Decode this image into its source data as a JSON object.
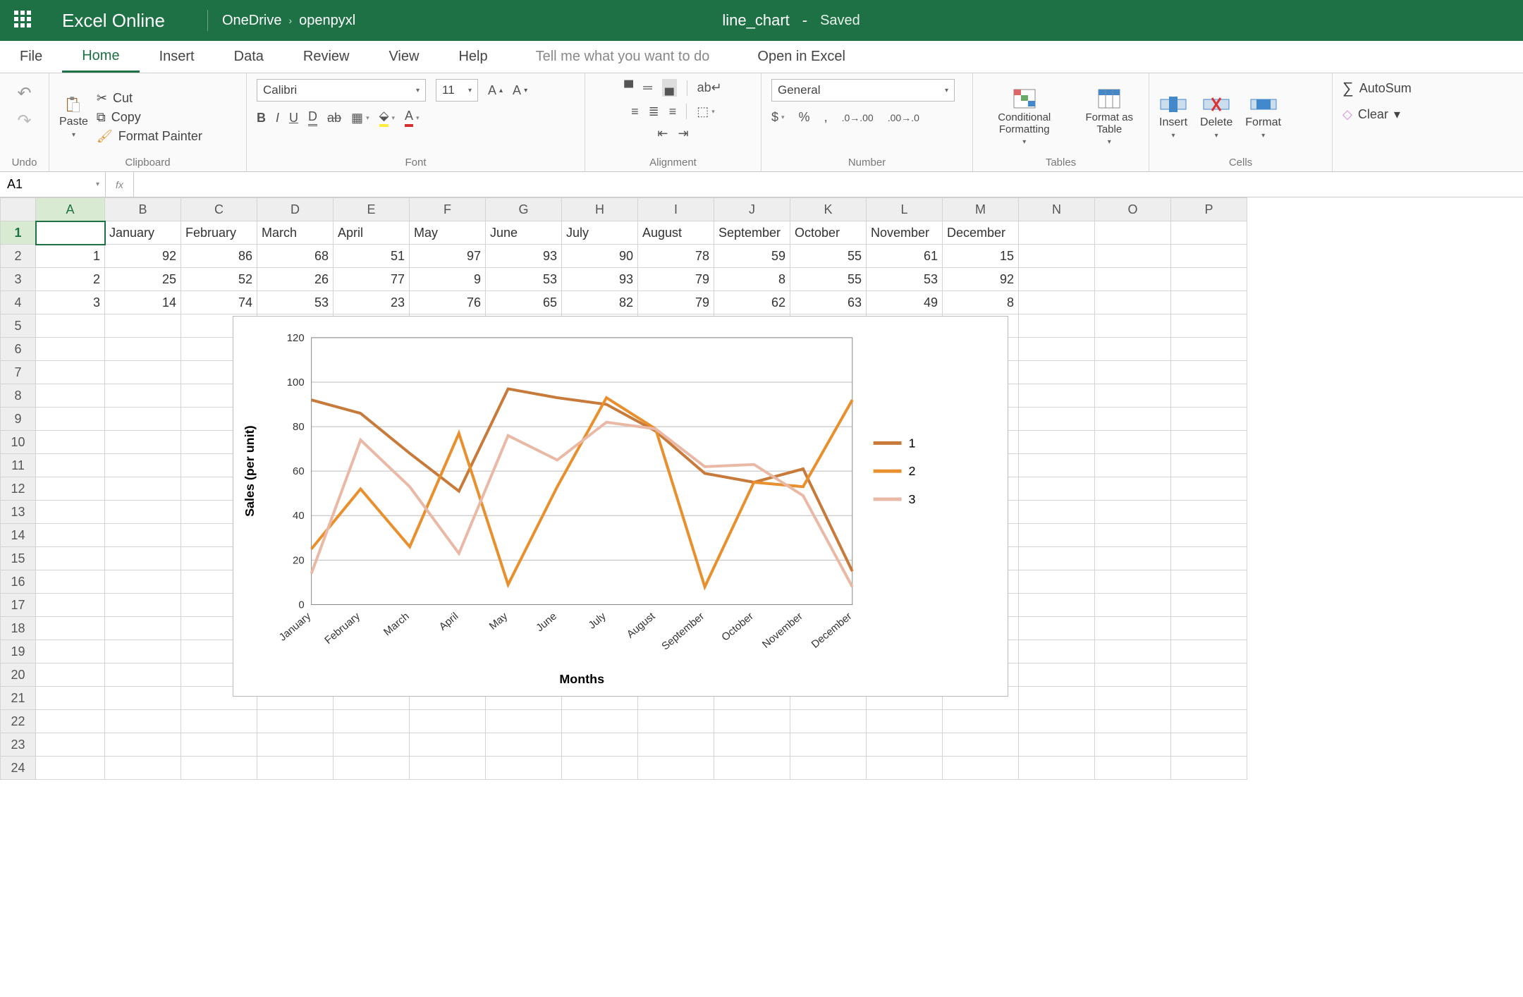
{
  "header": {
    "app_name": "Excel Online",
    "location": "OneDrive",
    "folder": "openpyxl",
    "doc_title": "line_chart",
    "status_sep": "-",
    "status": "Saved"
  },
  "tabs": {
    "file": "File",
    "home": "Home",
    "insert": "Insert",
    "data": "Data",
    "review": "Review",
    "view": "View",
    "help": "Help",
    "tellme": "Tell me what you want to do",
    "open_in_excel": "Open in Excel"
  },
  "ribbon": {
    "undo_label": "Undo",
    "paste": "Paste",
    "cut": "Cut",
    "copy": "Copy",
    "format_painter": "Format Painter",
    "clipboard_label": "Clipboard",
    "font_name": "Calibri",
    "font_size": "11",
    "font_label": "Font",
    "alignment_label": "Alignment",
    "number_format": "General",
    "number_label": "Number",
    "cond_fmt": "Conditional Formatting",
    "fmt_table": "Format as Table",
    "tables_label": "Tables",
    "insert": "Insert",
    "delete": "Delete",
    "format": "Format",
    "cells_label": "Cells",
    "autosum": "AutoSum",
    "clear": "Clear"
  },
  "namebox": {
    "ref": "A1",
    "fx": "fx"
  },
  "columns": [
    "A",
    "B",
    "C",
    "D",
    "E",
    "F",
    "G",
    "H",
    "I",
    "J",
    "K",
    "L",
    "M",
    "N",
    "O",
    "P"
  ],
  "row_headers": [
    "",
    "January",
    "February",
    "March",
    "April",
    "May",
    "June",
    "July",
    "August",
    "September",
    "October",
    "November",
    "December"
  ],
  "rows": [
    {
      "A": "1",
      "vals": [
        92,
        86,
        68,
        51,
        97,
        93,
        90,
        78,
        59,
        55,
        61,
        15
      ]
    },
    {
      "A": "2",
      "vals": [
        25,
        52,
        26,
        77,
        9,
        53,
        93,
        79,
        8,
        55,
        53,
        92
      ]
    },
    {
      "A": "3",
      "vals": [
        14,
        74,
        53,
        23,
        76,
        65,
        82,
        79,
        62,
        63,
        49,
        8
      ]
    }
  ],
  "visible_rows": 24,
  "chart_data": {
    "type": "line",
    "categories": [
      "January",
      "February",
      "March",
      "April",
      "May",
      "June",
      "July",
      "August",
      "September",
      "October",
      "November",
      "December"
    ],
    "series": [
      {
        "name": "1",
        "values": [
          92,
          86,
          68,
          51,
          97,
          93,
          90,
          78,
          59,
          55,
          61,
          15
        ],
        "color": "#c77a3a"
      },
      {
        "name": "2",
        "values": [
          25,
          52,
          26,
          77,
          9,
          53,
          93,
          79,
          8,
          55,
          53,
          92
        ],
        "color": "#e8902e"
      },
      {
        "name": "3",
        "values": [
          14,
          74,
          53,
          23,
          76,
          65,
          82,
          79,
          62,
          63,
          49,
          8
        ],
        "color": "#e9b9a6"
      }
    ],
    "ylabel": "Sales (per unit)",
    "xlabel": "Months",
    "ylim": [
      0,
      120
    ],
    "yticks": [
      0,
      20,
      40,
      60,
      80,
      100,
      120
    ]
  }
}
